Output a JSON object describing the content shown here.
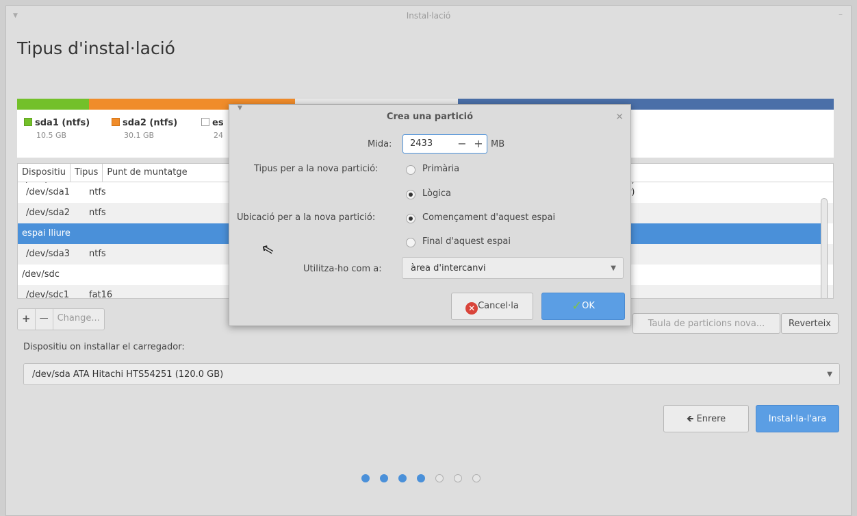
{
  "window": {
    "title": "Instal·lació"
  },
  "page": {
    "title": "Tipus d'instal·lació"
  },
  "partition_bar": {
    "segments": [
      {
        "color": "#73c02a",
        "fraction": 0.088
      },
      {
        "color": "#f08c2a",
        "fraction": 0.252
      },
      {
        "color": "#e9e9e9",
        "fraction": 0.2
      },
      {
        "color": "#4a6fa8",
        "fraction": 0.46
      }
    ]
  },
  "legend": [
    {
      "name": "sda1 (ntfs)",
      "size": "10.5 GB",
      "color": "#73c02a",
      "icon": "green-swatch"
    },
    {
      "name": "sda2 (ntfs)",
      "size": "30.1 GB",
      "color": "#f08c2a",
      "icon": "orange-swatch"
    },
    {
      "name": "es",
      "size": "24",
      "color": "#ffffff",
      "icon": "empty-swatch"
    }
  ],
  "table": {
    "headers": [
      "Dispositiu",
      "Tipus",
      "Punt de muntatge"
    ],
    "rows": [
      {
        "device": "/dev/sda1",
        "type": "ntfs",
        "extra": "er)"
      },
      {
        "device": "/dev/sda2",
        "type": "ntfs",
        "extra": ""
      },
      {
        "device": "espai lliure",
        "type": "",
        "extra": ""
      },
      {
        "device": "/dev/sda3",
        "type": "ntfs",
        "extra": ""
      },
      {
        "device": "/dev/sdc",
        "type": "",
        "extra": ""
      },
      {
        "device": "/dev/sdc1",
        "type": "fat16",
        "extra": ""
      }
    ]
  },
  "toolbar": {
    "add": "+",
    "remove": "—",
    "change": "Change..."
  },
  "buttons": {
    "new_table": "Taula de particions nova...",
    "revert": "Reverteix",
    "back": "Enrere",
    "back_icon": "arrow-left-icon",
    "install": "Instal·la-l'ara"
  },
  "bootloader": {
    "label": "Dispositiu on installar el carregador:",
    "value": "/dev/sda   ATA Hitachi HTS54251 (120.0 GB)"
  },
  "progress": {
    "total_steps": 7,
    "current_step": 4
  },
  "dialog": {
    "title": "Crea una partició",
    "size_label": "Mida:",
    "size_value": "2433",
    "size_unit": "MB",
    "minus": "−",
    "plus": "+",
    "type_label": "Tipus per a la nova partició:",
    "type_primary": "Primària",
    "type_logical": "Lògica",
    "location_label": "Ubicació per a la nova partició:",
    "location_begin": "Començament d'aquest espai",
    "location_end": "Final d'aquest espai",
    "use_label": "Utilitza-ho com a:",
    "use_value": "àrea d'intercanvi",
    "cancel": "Cancel·la",
    "ok": "OK"
  },
  "colors": {
    "accent": "#4a90d9",
    "selected_row": "#4a90d9"
  }
}
